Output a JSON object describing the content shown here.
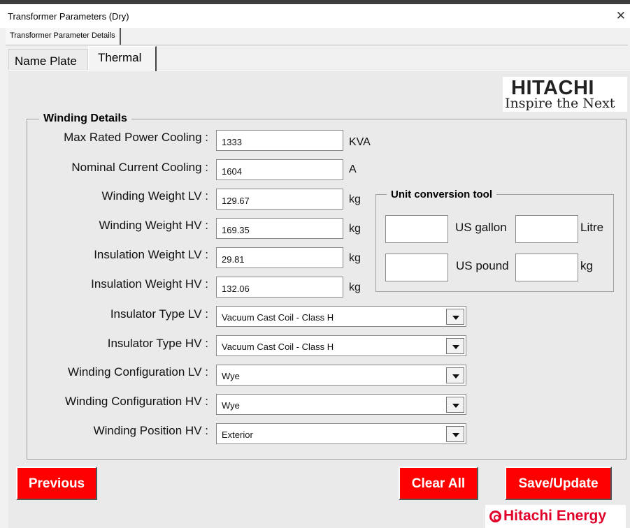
{
  "window": {
    "title": "Transformer Parameters (Dry)",
    "close_glyph": "✕"
  },
  "outer_tab": {
    "label": "Transformer Parameter Details"
  },
  "tabs": [
    {
      "label": "Name Plate"
    },
    {
      "label": "Thermal",
      "active": true
    }
  ],
  "logo": {
    "brand": "HITACHI",
    "tagline": "Inspire the Next"
  },
  "winding": {
    "title": "Winding Details",
    "fields": [
      {
        "label": "Max Rated Power Cooling :",
        "value": "1333",
        "unit": "KVA"
      },
      {
        "label": "Nominal Current Cooling :",
        "value": "1604",
        "unit": "A"
      },
      {
        "label": "Winding Weight LV :",
        "value": "129.67",
        "unit": "kg"
      },
      {
        "label": "Winding Weight HV :",
        "value": "169.35",
        "unit": "kg"
      },
      {
        "label": "Insulation Weight LV :",
        "value": "29.81",
        "unit": "kg"
      },
      {
        "label": "Insulation Weight HV :",
        "value": "132.06",
        "unit": "kg"
      }
    ],
    "selects": [
      {
        "label": "Insulator Type LV :",
        "value": "Vacuum Cast Coil - Class H"
      },
      {
        "label": "Insulator Type HV :",
        "value": "Vacuum Cast Coil - Class H"
      },
      {
        "label": "Winding Configuration LV :",
        "value": "Wye"
      },
      {
        "label": "Winding Configuration HV :",
        "value": "Wye"
      },
      {
        "label": "Winding Position HV :",
        "value": "Exterior"
      }
    ]
  },
  "converter": {
    "title": "Unit conversion tool",
    "row1": {
      "left_label": "US gallon",
      "right_label": "Litre"
    },
    "row2": {
      "left_label": "US pound",
      "right_label": "kg"
    }
  },
  "buttons": {
    "previous": "Previous",
    "clear_all": "Clear All",
    "save_update": "Save/Update"
  },
  "footer_logo": {
    "text": "Hitachi Energy"
  },
  "colors": {
    "button_red": "#ff0000",
    "energy_red": "#e0002a"
  }
}
